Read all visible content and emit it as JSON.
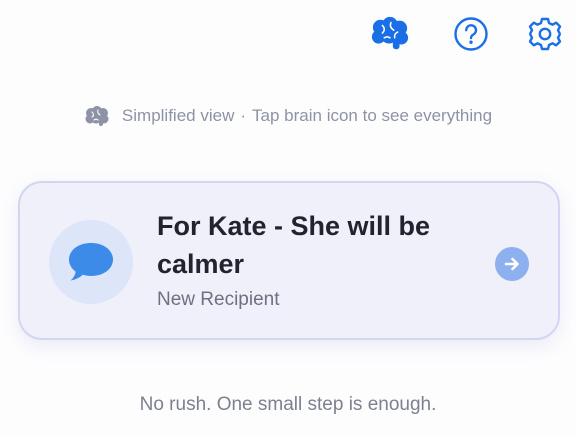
{
  "header": {
    "brain_icon": "brain-icon",
    "help_icon": "question-mark-icon",
    "settings_icon": "gear-icon",
    "accent_color": "#1a73e8"
  },
  "hint": {
    "mode": "Simplified view",
    "separator": "·",
    "instruction": "Tap brain icon to see everything"
  },
  "card": {
    "title": "For Kate - She will be calmer",
    "subtitle": "New Recipient",
    "icon": "speech-bubble-icon",
    "action_icon": "arrow-right-icon"
  },
  "footer": {
    "note": "No rush. One small step is enough."
  }
}
